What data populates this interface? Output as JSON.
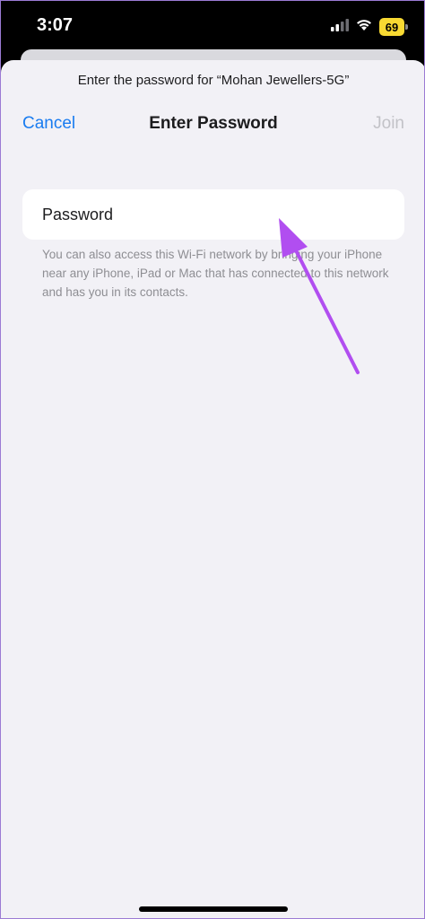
{
  "status_bar": {
    "time": "3:07",
    "battery_level": "69",
    "battery_color": "#f8d932",
    "signal_icon": "cellular-signal-icon",
    "wifi_icon": "wifi-icon"
  },
  "sheet": {
    "prompt": "Enter the password for “Mohan Jewellers-5G”",
    "cancel_label": "Cancel",
    "title": "Enter Password",
    "join_label": "Join",
    "password_placeholder": "Password",
    "password_value": "",
    "help_text": "You can also access this Wi-Fi network by bringing your iPhone near any iPhone, iPad or Mac that has connected to this network and has you in its contacts."
  },
  "annotation": {
    "arrow_color": "#b14ef0",
    "arrow_icon": "pointer-arrow-icon"
  },
  "colors": {
    "accent": "#1a7cf0",
    "disabled": "#c2c2c7",
    "sheet_background": "#f2f1f6"
  }
}
